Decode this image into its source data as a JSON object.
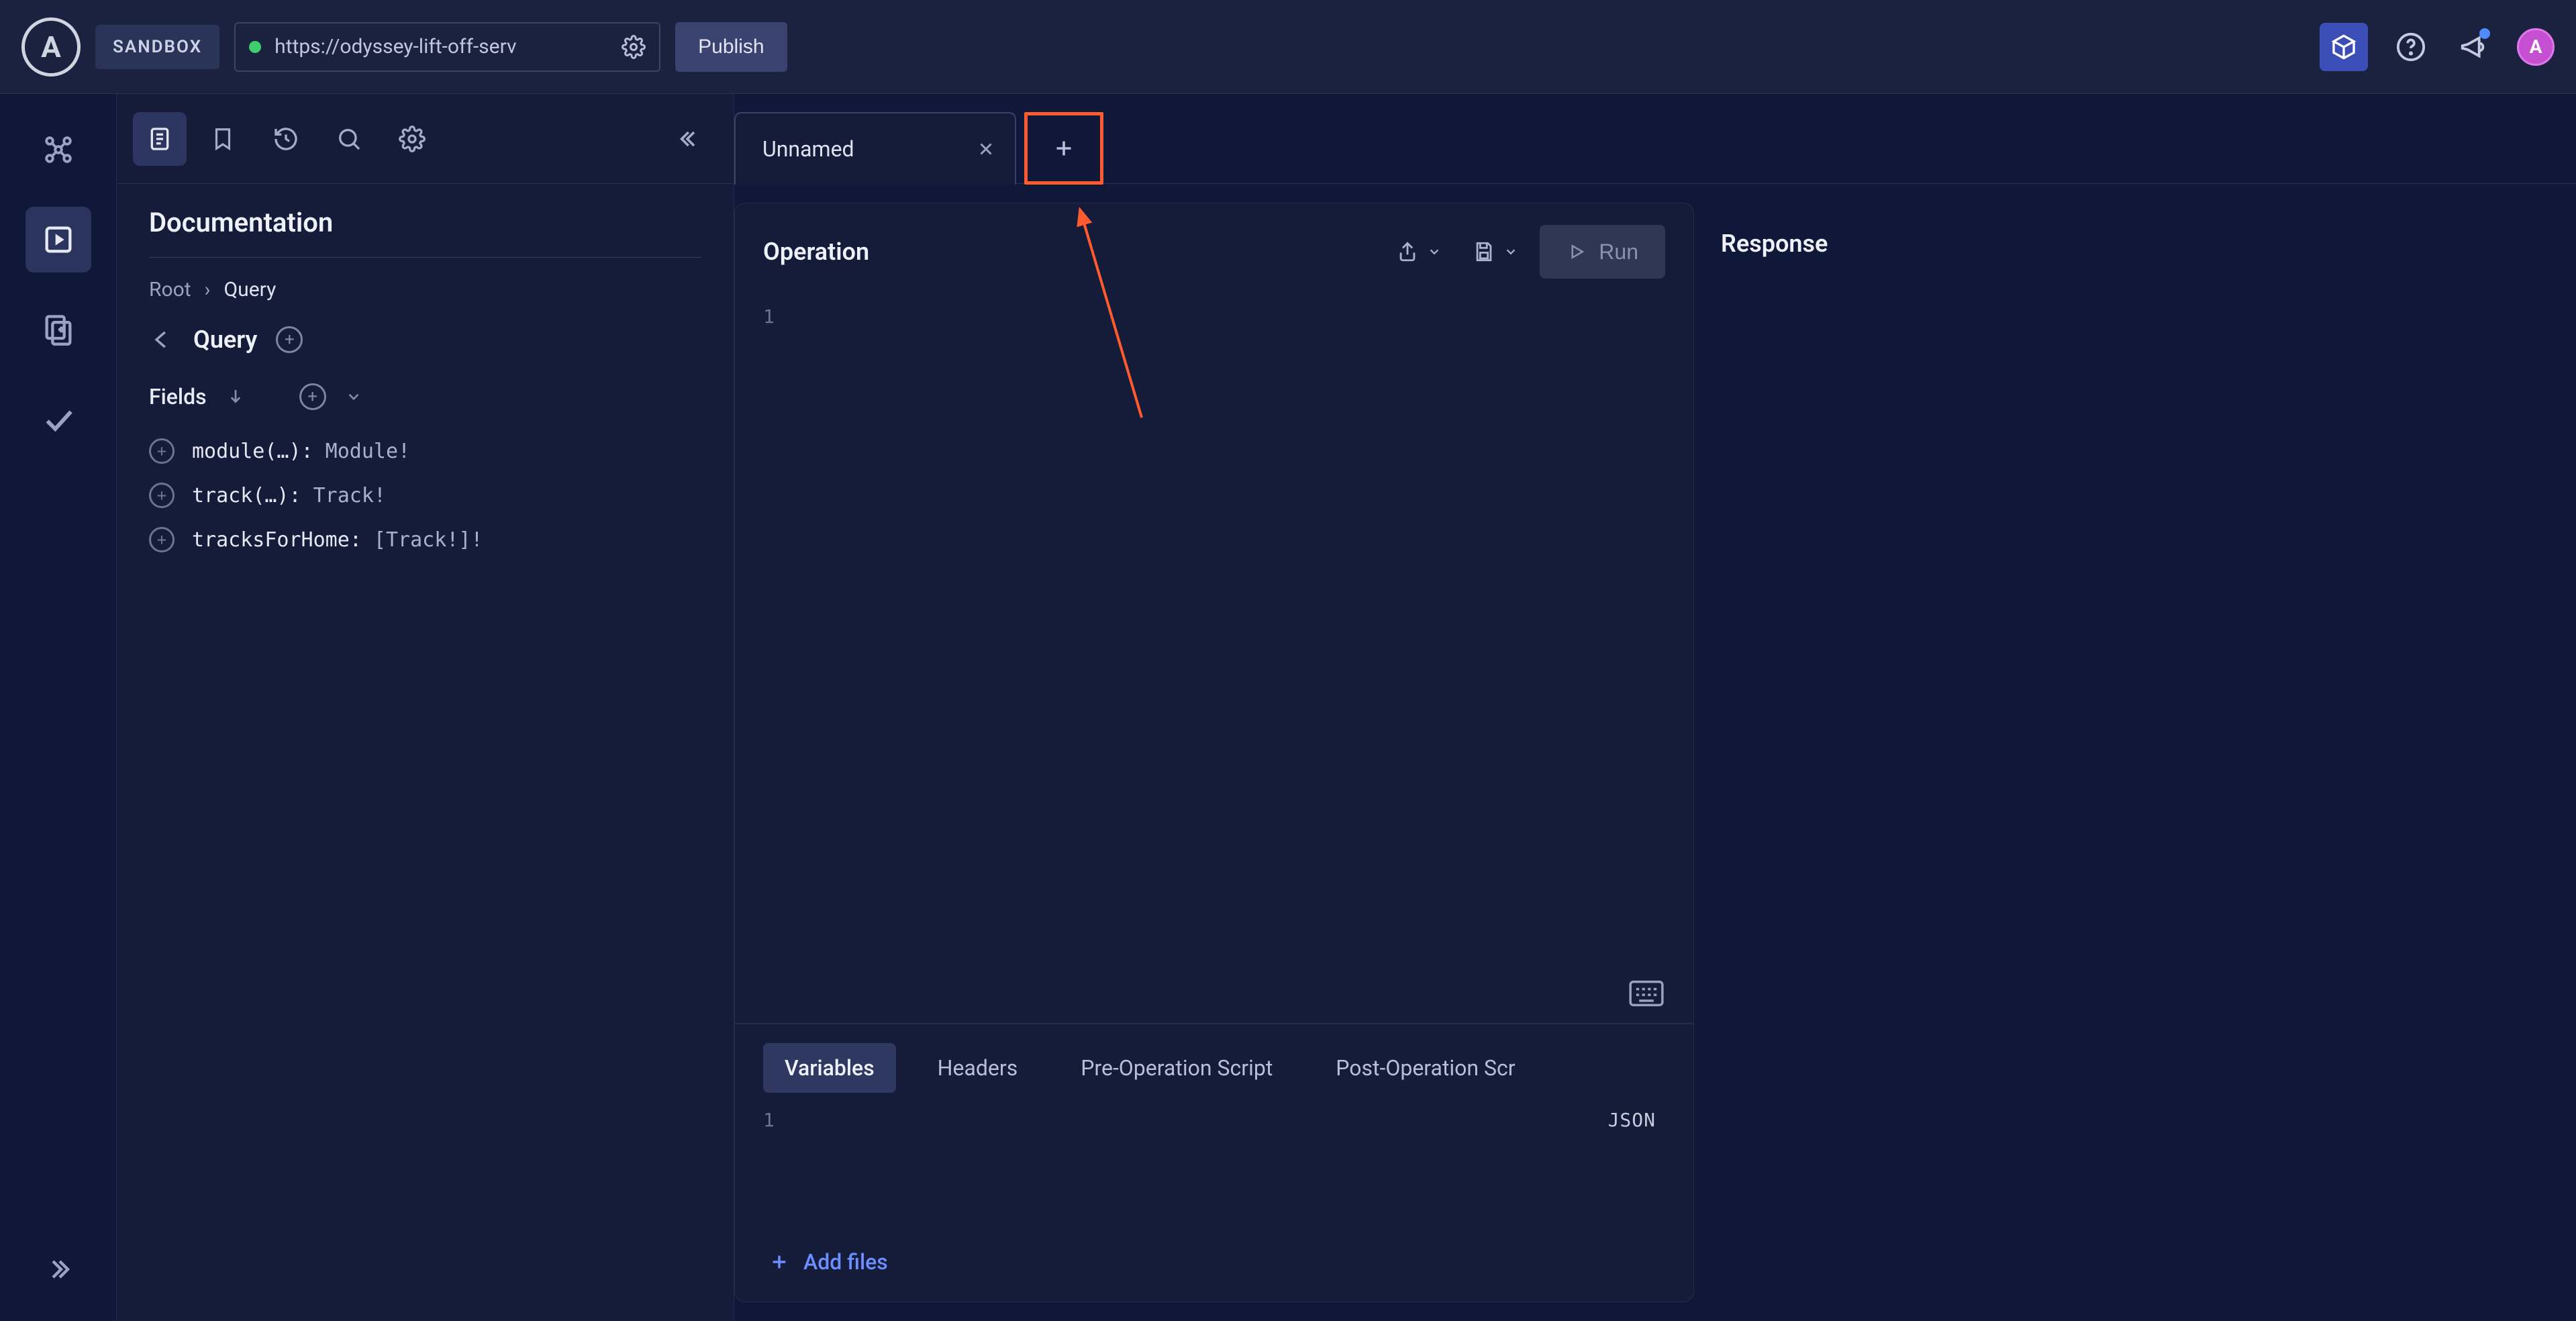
{
  "topbar": {
    "logo_letter": "A",
    "env_label": "SANDBOX",
    "url": "https://odyssey-lift-off-serv",
    "publish_label": "Publish",
    "avatar_letter": "A"
  },
  "sidebar": {
    "title": "Documentation",
    "breadcrumb_root": "Root",
    "breadcrumb_sep": "›",
    "breadcrumb_current": "Query",
    "type_name": "Query",
    "fields_label": "Fields",
    "fields": [
      {
        "name": "module",
        "args": "(…):",
        "type": " Module!"
      },
      {
        "name": "track",
        "args": "(…):",
        "type": " Track!"
      },
      {
        "name": "tracksForHome",
        "args": ":",
        "type": " [Track!]!"
      }
    ]
  },
  "tabs": {
    "items": [
      {
        "label": "Unnamed"
      }
    ]
  },
  "operation": {
    "title": "Operation",
    "run_label": "Run",
    "line1": "1"
  },
  "bottom": {
    "tabs": [
      {
        "label": "Variables",
        "active": true
      },
      {
        "label": "Headers",
        "active": false
      },
      {
        "label": "Pre-Operation Script",
        "active": false
      },
      {
        "label": "Post-Operation Scr",
        "active": false
      }
    ],
    "format_label": "JSON",
    "line1": "1",
    "add_files_label": "Add files"
  },
  "response": {
    "title": "Response"
  }
}
